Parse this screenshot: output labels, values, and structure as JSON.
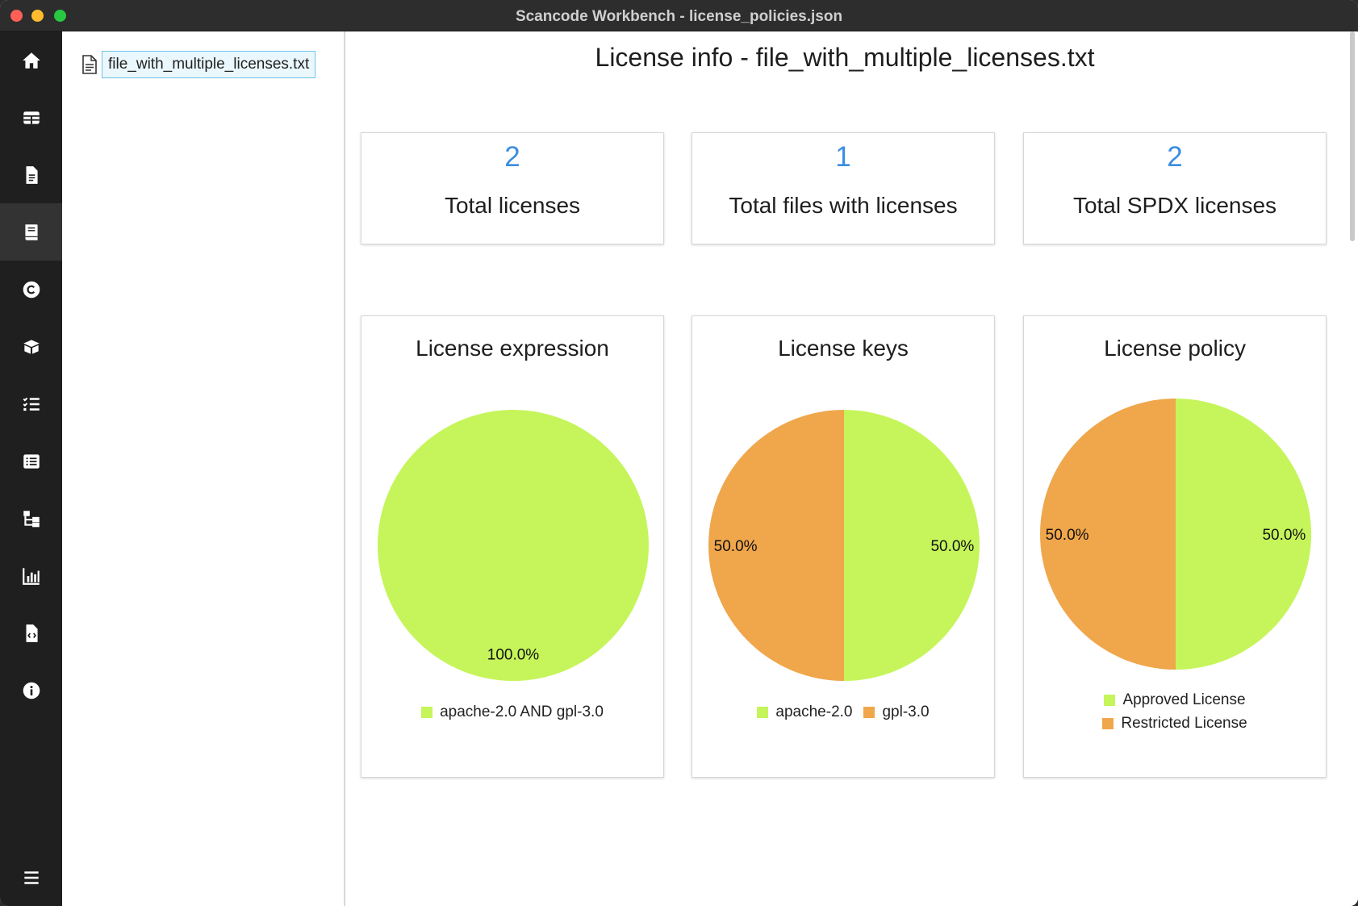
{
  "window": {
    "title": "Scancode Workbench - license_policies.json"
  },
  "sidebar": {
    "items": [
      {
        "icon": "home-icon",
        "active": false
      },
      {
        "icon": "table-icon",
        "active": false
      },
      {
        "icon": "file-text-icon",
        "active": false
      },
      {
        "icon": "book-icon",
        "active": true
      },
      {
        "icon": "copyright-icon",
        "active": false
      },
      {
        "icon": "package-icon",
        "active": false
      },
      {
        "icon": "checklist-icon",
        "active": false
      },
      {
        "icon": "list-icon",
        "active": false
      },
      {
        "icon": "folder-tree-icon",
        "active": false
      },
      {
        "icon": "bar-chart-icon",
        "active": false
      },
      {
        "icon": "file-code-icon",
        "active": false
      },
      {
        "icon": "info-icon",
        "active": false
      }
    ],
    "menu_icon": "hamburger-menu-icon"
  },
  "file_tree": {
    "selected_file": "file_with_multiple_licenses.txt"
  },
  "main": {
    "title": "License info - file_with_multiple_licenses.txt",
    "stats": [
      {
        "value": "2",
        "label": "Total licenses"
      },
      {
        "value": "1",
        "label": "Total files with licenses"
      },
      {
        "value": "2",
        "label": "Total SPDX licenses"
      }
    ]
  },
  "colors": {
    "green": "#c5f55a",
    "orange": "#f0a64b",
    "accent": "#3b8de0"
  },
  "chart_data": [
    {
      "type": "pie",
      "title": "License expression",
      "categories": [
        "apache-2.0 AND gpl-3.0"
      ],
      "values": [
        100.0
      ],
      "labels": [
        "100.0%"
      ],
      "colors": [
        "#c5f55a"
      ],
      "legend": "bottom"
    },
    {
      "type": "pie",
      "title": "License keys",
      "categories": [
        "apache-2.0",
        "gpl-3.0"
      ],
      "values": [
        50.0,
        50.0
      ],
      "labels": [
        "50.0%",
        "50.0%"
      ],
      "colors": [
        "#c5f55a",
        "#f0a64b"
      ],
      "legend": "bottom"
    },
    {
      "type": "pie",
      "title": "License policy",
      "categories": [
        "Approved License",
        "Restricted License"
      ],
      "values": [
        50.0,
        50.0
      ],
      "labels": [
        "50.0%",
        "50.0%"
      ],
      "colors": [
        "#c5f55a",
        "#f0a64b"
      ],
      "legend": "bottom"
    }
  ]
}
